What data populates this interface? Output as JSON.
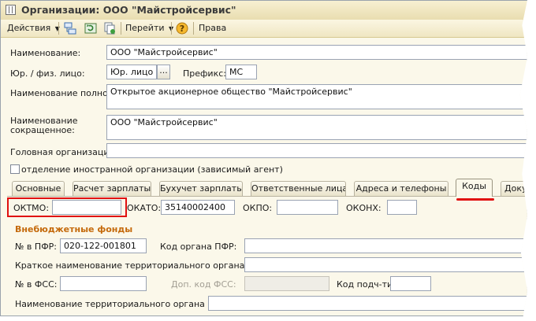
{
  "window": {
    "title": "Организации: ООО \"Майстройсервис\""
  },
  "toolbar": {
    "actions": "Действия",
    "goto": "Перейти",
    "rights": "Права"
  },
  "form": {
    "name_label": "Наименование:",
    "name_value": "ООО \"Майстройсервис\"",
    "legal_label": "Юр. / физ. лицо:",
    "legal_value": "Юр. лицо",
    "legal_button": "...",
    "prefix_label": "Префикс:",
    "prefix_value": "МС",
    "fullname_label": "Наименование полное:",
    "fullname_value": "Открытое акционерное общество \"Майстройсервис\"",
    "shortname_label_1": "Наименование",
    "shortname_label_2": "сокращенное:",
    "shortname_value": "ООО \"Майстройсервис\"",
    "parent_label": "Головная организация:",
    "parent_value": "",
    "foreign_label": "отделение иностранной организации (зависимый агент)"
  },
  "tabs": [
    {
      "label": "Основные"
    },
    {
      "label": "Расчет зарплаты"
    },
    {
      "label": "Бухучет зарплаты"
    },
    {
      "label": "Ответственные лица"
    },
    {
      "label": "Адреса и телефоны"
    },
    {
      "label": "Коды"
    },
    {
      "label": "Докум"
    }
  ],
  "active_tab": "Коды",
  "codes": {
    "oktmo_label": "ОКТМО:",
    "oktmo_value": "",
    "okato_label": "ОКАТО:",
    "okato_value": "35140002400",
    "okpo_label": "ОКПО:",
    "okpo_value": "",
    "okonh_label": "ОКОНХ:",
    "okonh_value": "",
    "section_title": "Внебюджетные фонды",
    "pfr_no_label": "№ в ПФР:",
    "pfr_no_value": "020-122-001801",
    "pfr_code_label": "Код органа ПФР:",
    "pfr_code_value": "",
    "pfr_short_label": "Краткое наименование территориального органа ПФР:",
    "pfr_short_value": "",
    "fss_no_label": "№ в ФСС:",
    "fss_no_value": "",
    "fss_extra_label": "Доп. код ФСС:",
    "fss_extra_value": "",
    "subord_label": "Код подч-ти:",
    "subord_value": "",
    "fss_name_label": "Наименование территориального органа ФСС:",
    "fss_name_value": ""
  },
  "colors": {
    "highlight": "#e01010",
    "section": "#c56a0c",
    "background": "#fbf8ea"
  }
}
